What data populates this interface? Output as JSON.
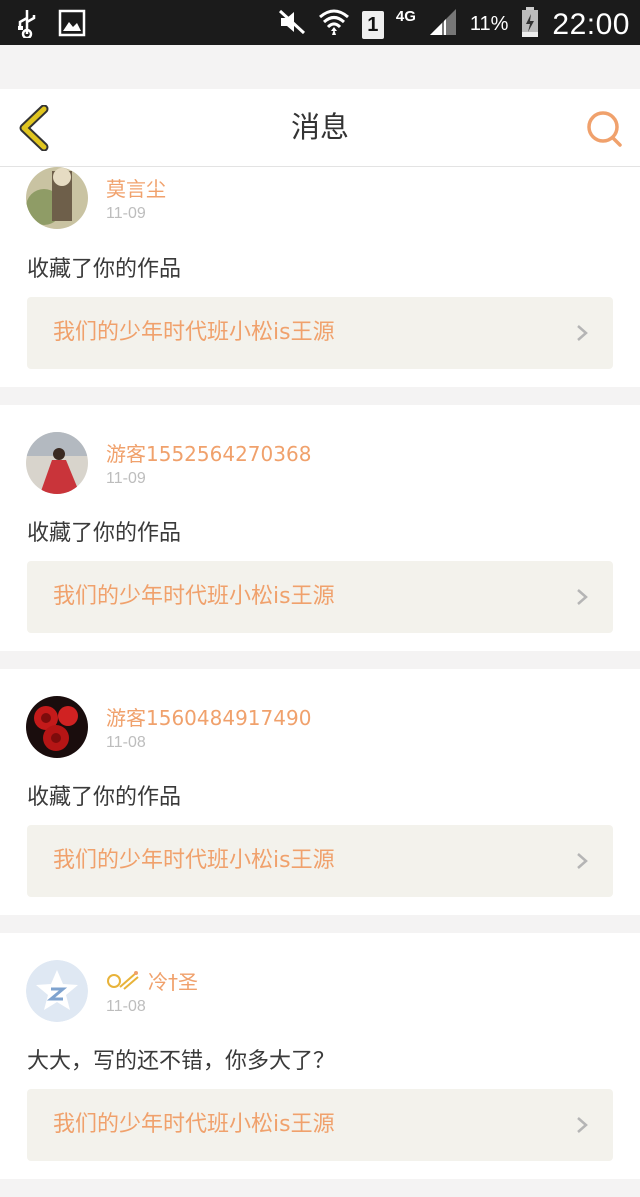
{
  "status_bar": {
    "sim": "1",
    "network": "4G",
    "battery": "11%",
    "time": "22:00"
  },
  "header": {
    "title": "消息",
    "back_icon": "back-chevron-icon",
    "search_icon": "search-icon"
  },
  "colors": {
    "accent": "#f0a16c",
    "back": "#e0c51f"
  },
  "messages": [
    {
      "user": "莫言尘",
      "date": "11-09",
      "text": "收藏了你的作品",
      "work_title": "我们的少年时代班小松is王源"
    },
    {
      "user": "游客1552564270368",
      "date": "11-09",
      "text": "收藏了你的作品",
      "work_title": "我们的少年时代班小松is王源"
    },
    {
      "user": "游客1560484917490",
      "date": "11-08",
      "text": "收藏了你的作品",
      "work_title": "我们的少年时代班小松is王源"
    },
    {
      "user": "冷†圣",
      "date": "11-08",
      "text": "大大，写的还不错，你多大了？",
      "work_title": "我们的少年时代班小松is王源"
    }
  ]
}
